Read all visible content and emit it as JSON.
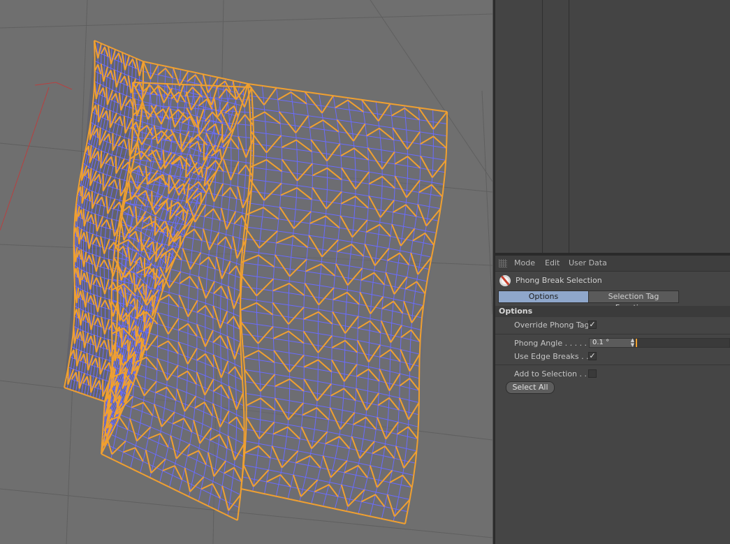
{
  "menubar": {
    "items": [
      "Mode",
      "Edit",
      "User Data"
    ]
  },
  "object": {
    "icon": "phong-break-icon",
    "title": "Phong Break Selection"
  },
  "tabs": [
    {
      "label": "Options",
      "active": true
    },
    {
      "label": "Selection Tag Functions",
      "active": false
    }
  ],
  "group": {
    "title": "Options"
  },
  "fields": {
    "override_phong_tag": {
      "label": "Override Phong Tag",
      "checked": true
    },
    "phong_angle": {
      "label": "Phong Angle . . . . .",
      "value": "0.1 °"
    },
    "use_edge_breaks": {
      "label": "Use Edge Breaks . .",
      "checked": true
    },
    "add_to_selection": {
      "label": "Add to Selection . .",
      "checked": false
    }
  },
  "buttons": {
    "select_all": "Select All"
  },
  "colors": {
    "accent_tab": "#8fa7cb",
    "wire_orange": "#f0a030",
    "wire_blue": "#6a6cff",
    "viewport_bg": "#6f6f6f"
  }
}
